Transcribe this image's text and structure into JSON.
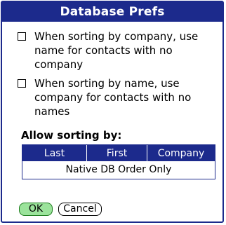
{
  "window": {
    "title": "Database Prefs"
  },
  "options": [
    {
      "label": "When sorting by company, use name for contacts with no company",
      "checked": false
    },
    {
      "label": "When sorting by name, use company for contacts with no names",
      "checked": false
    }
  ],
  "sorting": {
    "label": "Allow sorting by:",
    "columns": [
      "Last",
      "First",
      "Company"
    ],
    "row": "Native DB Order Only"
  },
  "buttons": {
    "ok": "OK",
    "cancel": "Cancel"
  },
  "colors": {
    "accent": "#1c2a8c",
    "ok_highlight": "#9be39b"
  }
}
